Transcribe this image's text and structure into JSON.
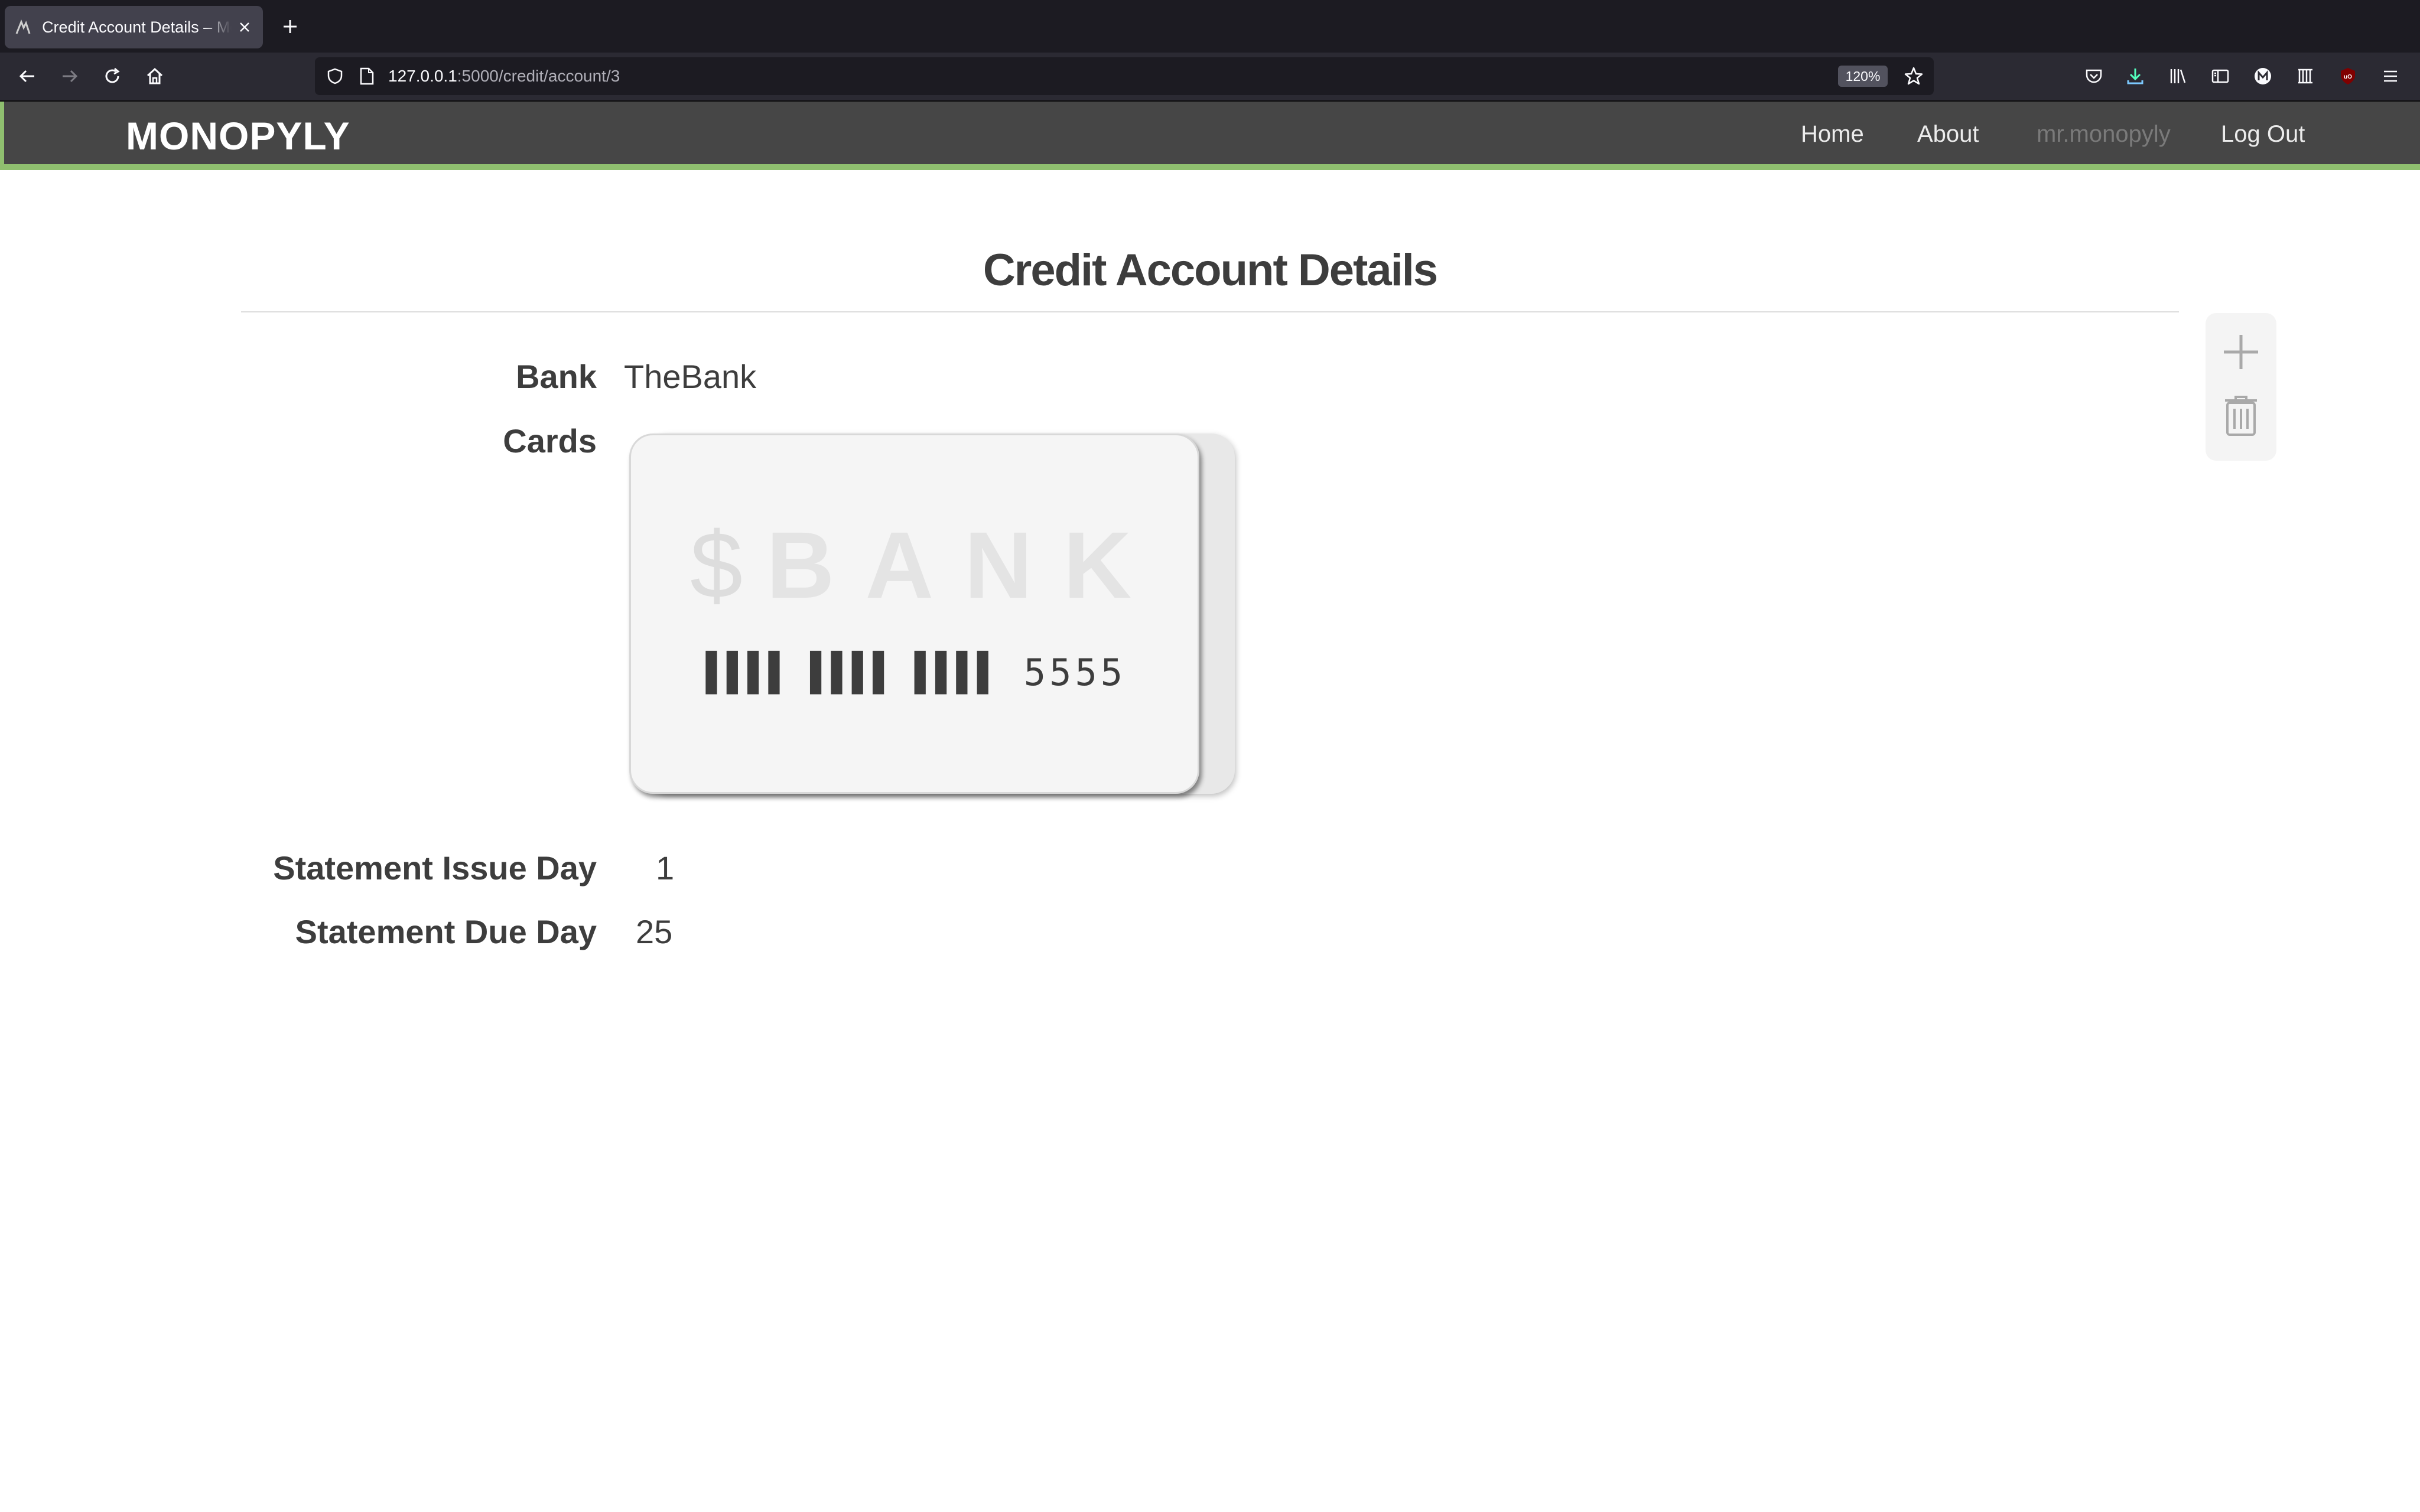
{
  "browser": {
    "tab_title": "Credit Account Details – Monopyly",
    "url_host": "127.0.0.1",
    "url_path": ":5000/credit/account/3",
    "zoom": "120%"
  },
  "header": {
    "brand": "MONOPYLY",
    "nav": {
      "home": "Home",
      "about": "About",
      "user": "mr.monopyly",
      "logout": "Log Out"
    },
    "accent_color": "#8fbf6f"
  },
  "page": {
    "title": "Credit Account Details",
    "fields": {
      "bank_label": "Bank",
      "bank_value": "TheBank",
      "cards_label": "Cards",
      "issue_label": "Statement Issue Day",
      "issue_value": "1",
      "due_label": "Statement Due Day",
      "due_value": "25"
    },
    "card": {
      "logo_symbol": "$",
      "logo_text": "BANK",
      "mask": "▌▌▌▌ ▌▌▌▌ ▌▌▌▌",
      "last_four": "5555"
    }
  },
  "actions": {
    "add_icon": "plus-icon",
    "delete_icon": "trash-icon"
  }
}
